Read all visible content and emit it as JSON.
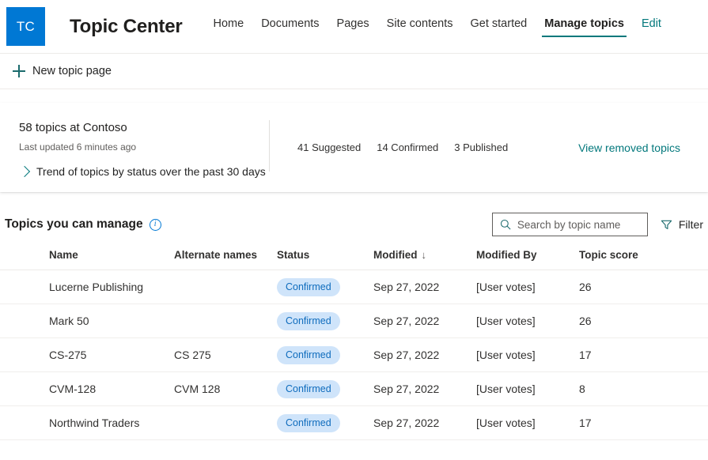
{
  "header": {
    "logo_text": "TC",
    "site_title": "Topic Center",
    "nav": [
      {
        "label": "Home",
        "state": "normal"
      },
      {
        "label": "Documents",
        "state": "normal"
      },
      {
        "label": "Pages",
        "state": "normal"
      },
      {
        "label": "Site contents",
        "state": "normal"
      },
      {
        "label": "Get started",
        "state": "normal"
      },
      {
        "label": "Manage topics",
        "state": "selected"
      },
      {
        "label": "Edit",
        "state": "link"
      }
    ],
    "accent_teal": "#03787c",
    "logo_blue": "#0078d4"
  },
  "command_bar": {
    "new_topic_page_label": "New topic page"
  },
  "summary": {
    "topics_count_text": "58 topics at Contoso",
    "last_updated_text": "Last updated 6 minutes ago",
    "trend_label": "Trend of topics by status over the past 30 days",
    "stats": [
      {
        "label": "41 Suggested"
      },
      {
        "label": "14 Confirmed"
      },
      {
        "label": "3 Published"
      }
    ],
    "view_removed_label": "View removed topics"
  },
  "topics_section": {
    "title": "Topics you can manage",
    "search_placeholder": "Search by topic name",
    "search_value": "",
    "filter_label": "Filter",
    "columns": [
      "Name",
      "Alternate names",
      "Status",
      "Modified",
      "Modified By",
      "Topic score"
    ],
    "sort_column": "Modified",
    "sort_arrow": "↓",
    "status_badge_bg": "#cfe4fa",
    "status_badge_fg": "#0f6cbd",
    "rows": [
      {
        "name": "Lucerne Publishing",
        "alternate_names": "",
        "status": "Confirmed",
        "modified": "Sep 27, 2022",
        "modified_by": "[User votes]",
        "topic_score": "26"
      },
      {
        "name": "Mark 50",
        "alternate_names": "",
        "status": "Confirmed",
        "modified": "Sep 27, 2022",
        "modified_by": "[User votes]",
        "topic_score": "26"
      },
      {
        "name": "CS-275",
        "alternate_names": "CS 275",
        "status": "Confirmed",
        "modified": "Sep 27, 2022",
        "modified_by": "[User votes]",
        "topic_score": "17"
      },
      {
        "name": "CVM-128",
        "alternate_names": "CVM 128",
        "status": "Confirmed",
        "modified": "Sep 27, 2022",
        "modified_by": "[User votes]",
        "topic_score": "8"
      },
      {
        "name": "Northwind Traders",
        "alternate_names": "",
        "status": "Confirmed",
        "modified": "Sep 27, 2022",
        "modified_by": "[User votes]",
        "topic_score": "17"
      }
    ]
  },
  "icons": {
    "add": "plus-icon",
    "search": "search-icon",
    "filter": "filter-icon",
    "info": "info-icon",
    "chevron": "chevron-right-icon",
    "sort": "sort-descending-icon"
  }
}
